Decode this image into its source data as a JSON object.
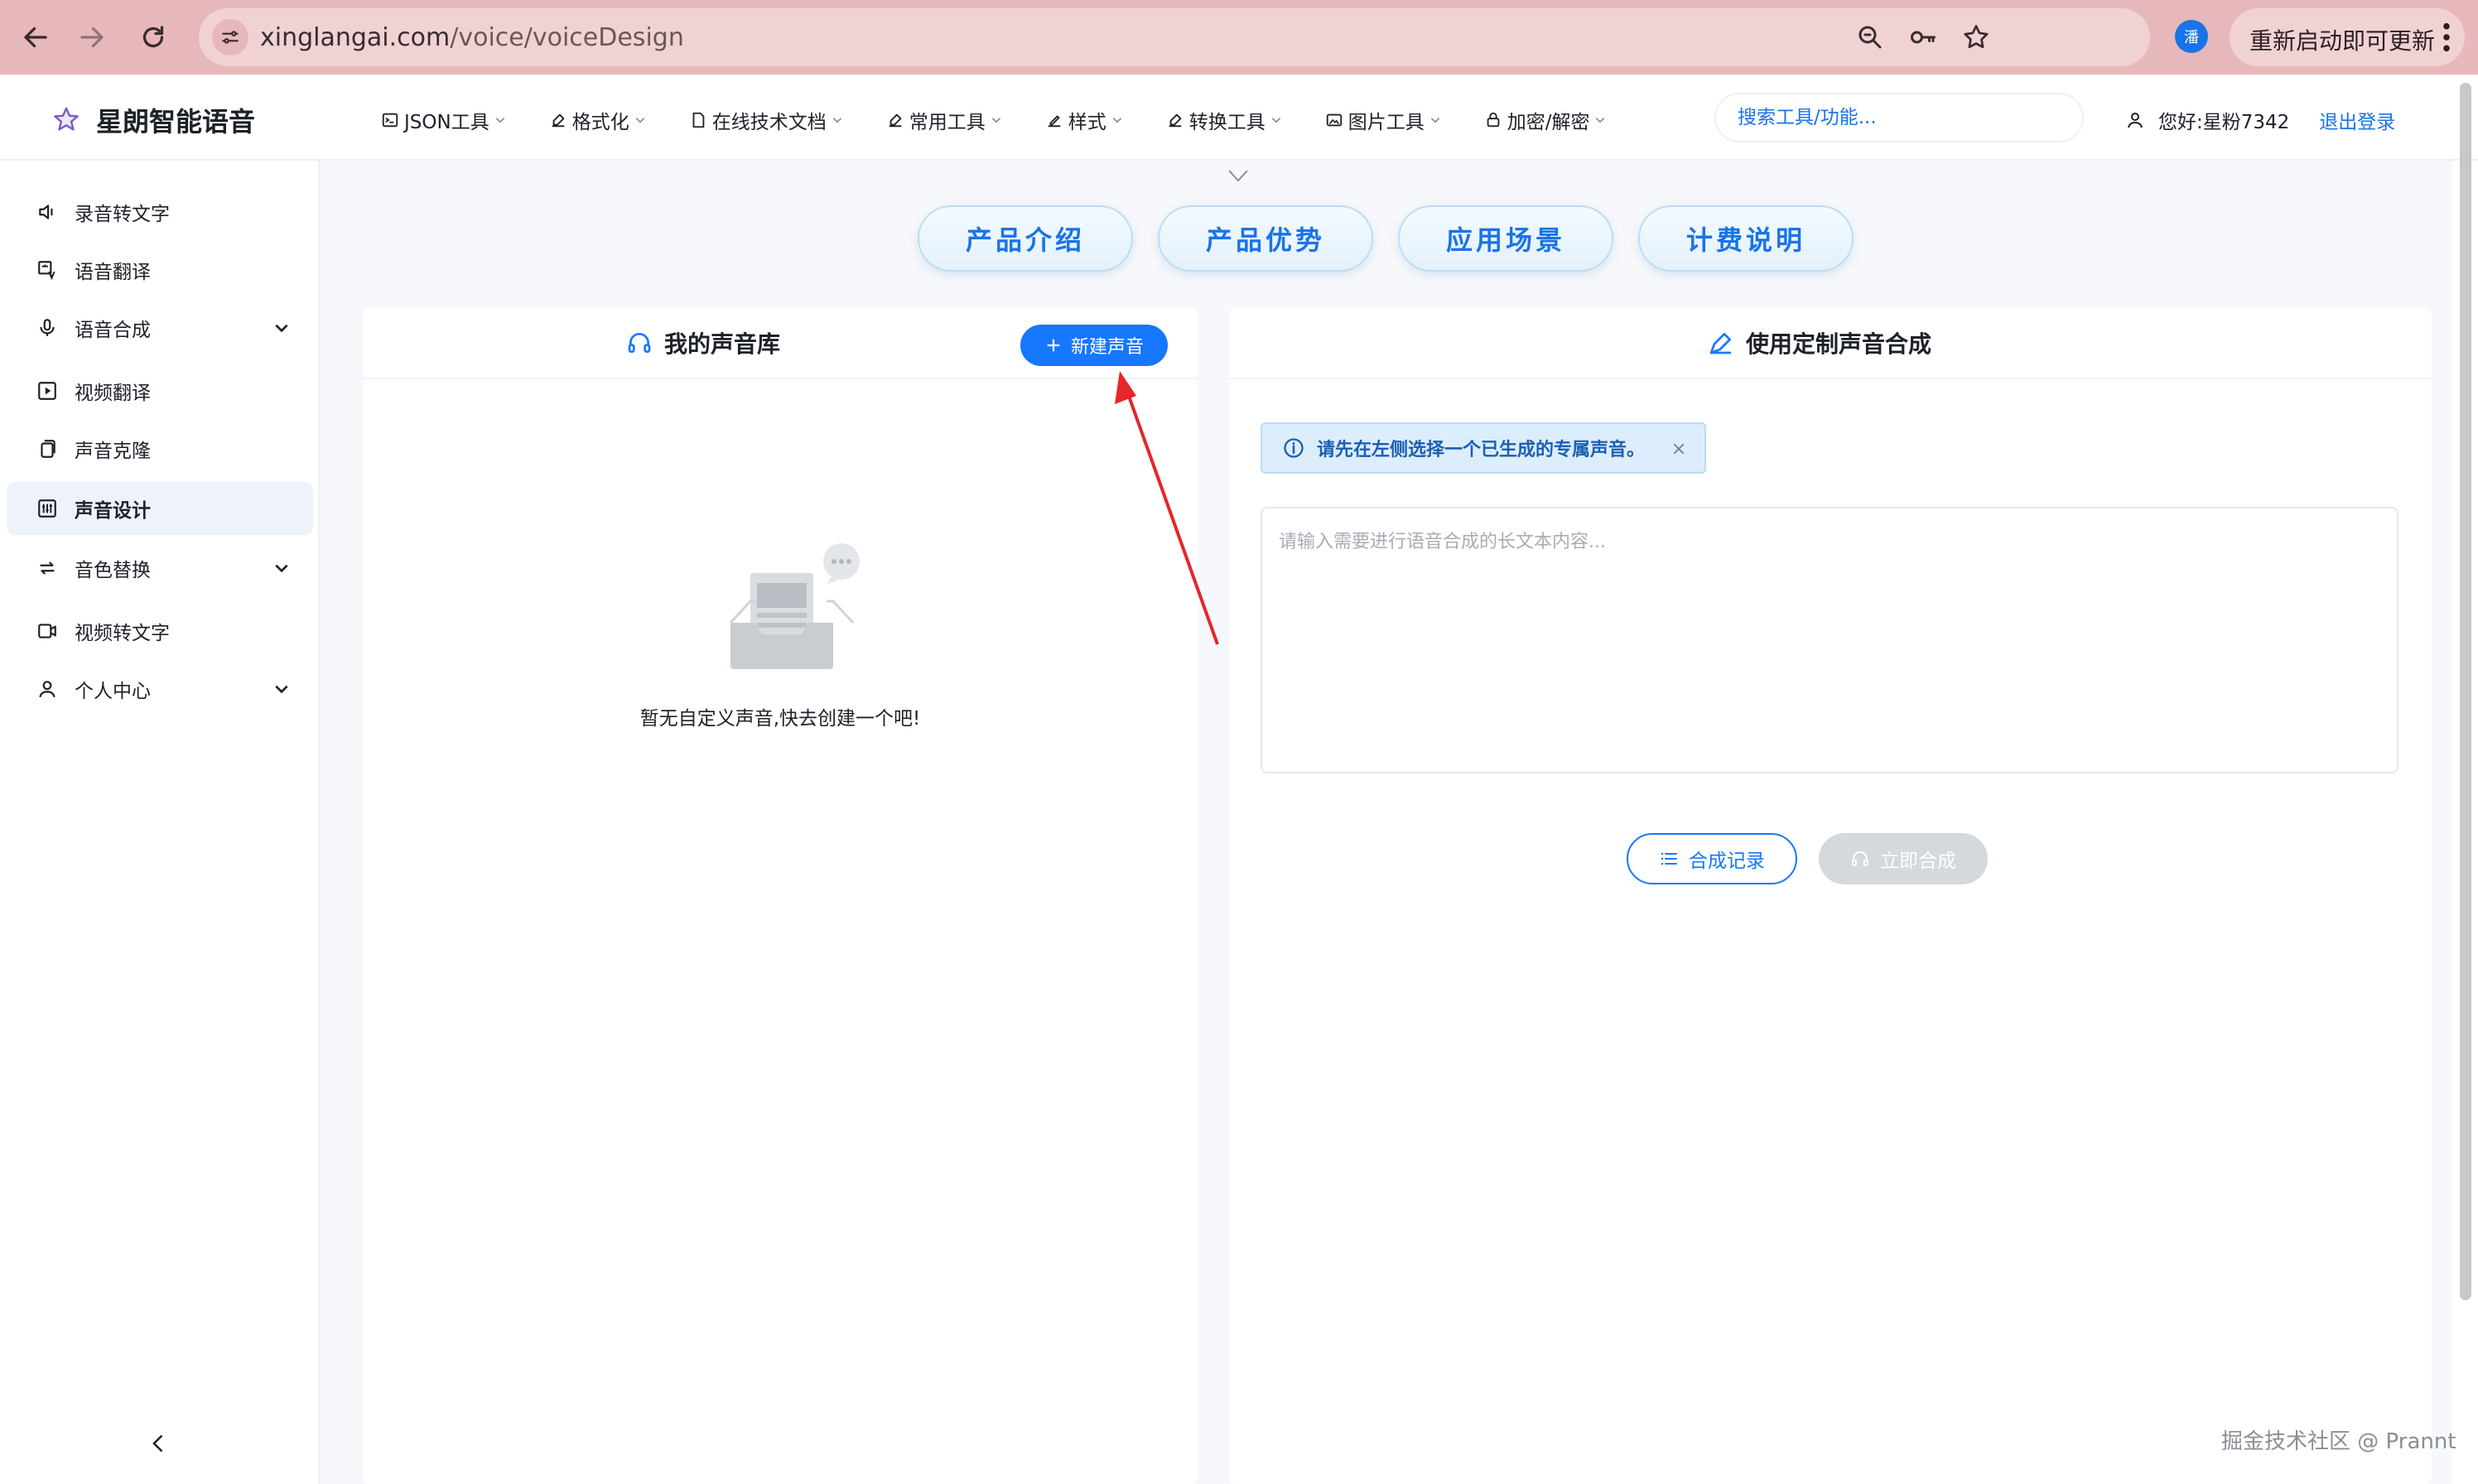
{
  "browser": {
    "url_host": "xinglangai.com",
    "url_path": "/voice/voiceDesign",
    "profile_initial": "潘",
    "update_label": "重新启动即可更新"
  },
  "app": {
    "brand": "星朗智能语音",
    "menu": [
      {
        "label": "JSON工具",
        "icon": "code-icon"
      },
      {
        "label": "格式化",
        "icon": "edit-icon"
      },
      {
        "label": "在线技术文档",
        "icon": "doc-icon"
      },
      {
        "label": "常用工具",
        "icon": "edit-icon"
      },
      {
        "label": "样式",
        "icon": "brush-icon"
      },
      {
        "label": "转换工具",
        "icon": "edit-icon"
      },
      {
        "label": "图片工具",
        "icon": "image-icon"
      },
      {
        "label": "加密/解密",
        "icon": "lock-icon"
      }
    ],
    "search_placeholder": "搜索工具/功能...",
    "greeting": "您好:星粉7342",
    "logout": "退出登录"
  },
  "sidebar": {
    "items": [
      {
        "label": "录音转文字",
        "icon": "speaker-icon",
        "active": false,
        "expandable": false
      },
      {
        "label": "语音翻译",
        "icon": "translate-icon",
        "active": false,
        "expandable": false
      },
      {
        "label": "语音合成",
        "icon": "mic-icon",
        "active": false,
        "expandable": true
      },
      {
        "label": "视频翻译",
        "icon": "play-box-icon",
        "active": false,
        "expandable": false
      },
      {
        "label": "声音克隆",
        "icon": "copy-icon",
        "active": false,
        "expandable": false
      },
      {
        "label": "声音设计",
        "icon": "equalizer-icon",
        "active": true,
        "expandable": false
      },
      {
        "label": "音色替换",
        "icon": "swap-icon",
        "active": false,
        "expandable": true
      },
      {
        "label": "视频转文字",
        "icon": "video-icon",
        "active": false,
        "expandable": false
      },
      {
        "label": "个人中心",
        "icon": "user-icon",
        "active": false,
        "expandable": true
      }
    ]
  },
  "tabs": [
    "产品介绍",
    "产品优势",
    "应用场景",
    "计费说明"
  ],
  "left_panel": {
    "title": "我的声音库",
    "new_button": "新建声音",
    "empty_text": "暂无自定义声音,快去创建一个吧!"
  },
  "right_panel": {
    "title": "使用定制声音合成",
    "alert": "请先在左侧选择一个已生成的专属声音。",
    "textarea_placeholder": "请输入需要进行语音合成的长文本内容...",
    "record_button": "合成记录",
    "synth_button": "立即合成"
  },
  "watermark": "掘金技术社区 @ Prannt",
  "colors": {
    "accent": "#1677ff",
    "chrome": "#e7b8bb",
    "annotation_arrow": "#e5262b"
  }
}
